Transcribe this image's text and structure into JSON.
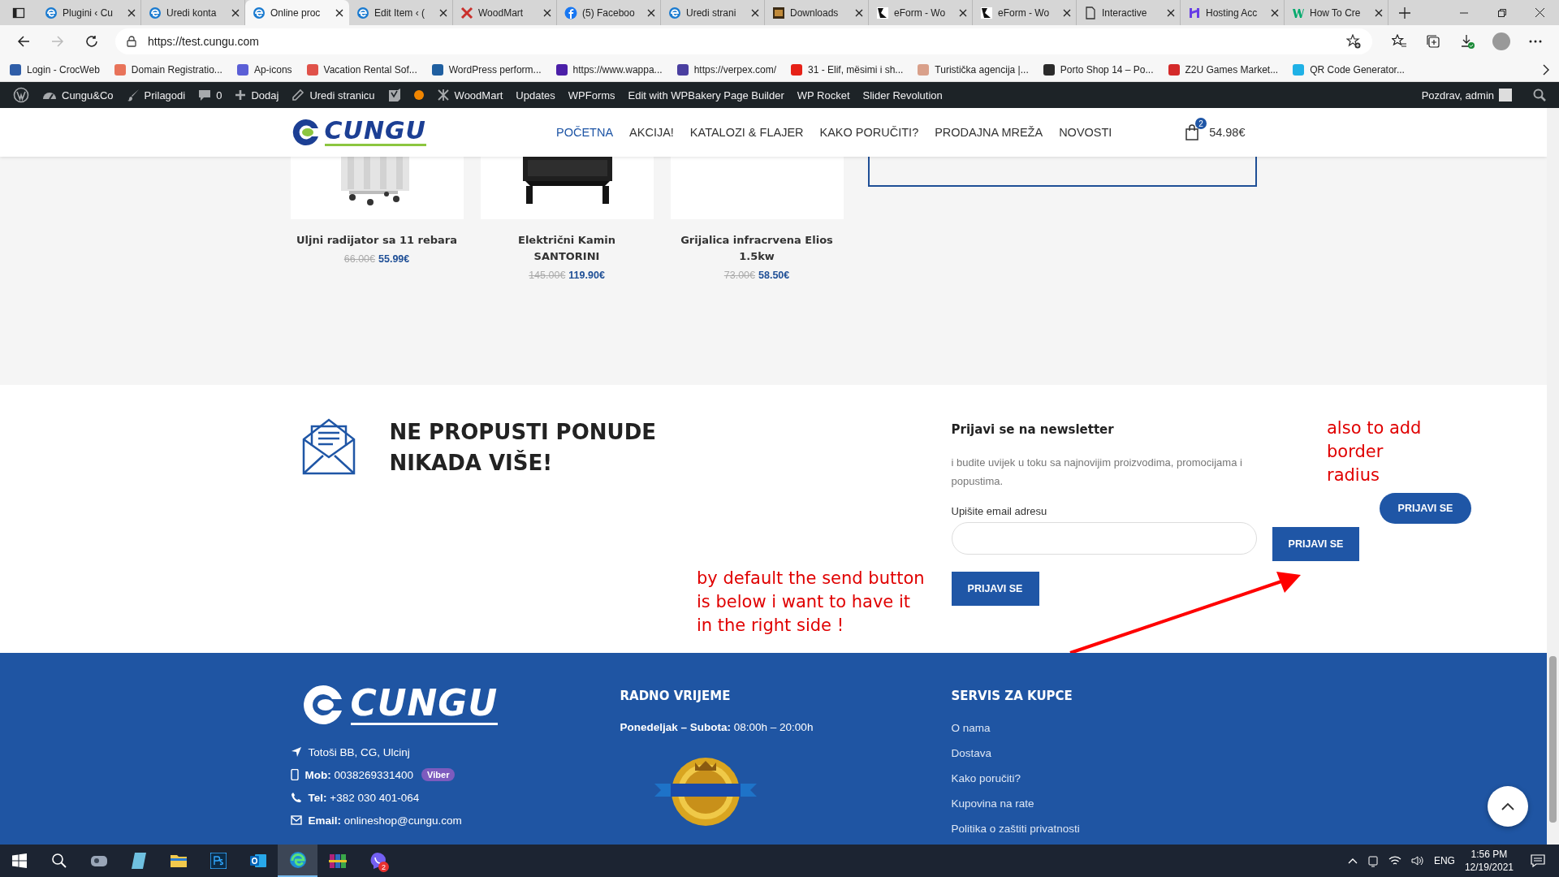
{
  "browser": {
    "tabs": [
      {
        "title": "Plugini ‹ Cu",
        "kind": "edge",
        "selected": false
      },
      {
        "title": "Uredi konta",
        "kind": "edge",
        "selected": false
      },
      {
        "title": "Online proc",
        "kind": "edge",
        "selected": true
      },
      {
        "title": "Edit Item ‹ (",
        "kind": "edge",
        "selected": false
      },
      {
        "title": "WoodMart",
        "kind": "woodmart",
        "selected": false
      },
      {
        "title": "(5) Faceboo",
        "kind": "facebook",
        "selected": false
      },
      {
        "title": "Uredi strani",
        "kind": "edge",
        "selected": false
      },
      {
        "title": "Downloads",
        "kind": "downloads",
        "selected": false
      },
      {
        "title": "eForm - Wo",
        "kind": "eform",
        "selected": false
      },
      {
        "title": "eForm - Wo",
        "kind": "eform",
        "selected": false
      },
      {
        "title": "Interactive",
        "kind": "page",
        "selected": false
      },
      {
        "title": "Hosting Acc",
        "kind": "hosting",
        "selected": false
      },
      {
        "title": "How To Cre",
        "kind": "w3",
        "selected": false
      }
    ],
    "url": "https://test.cungu.com",
    "bookmarks": [
      {
        "label": "Login - CrocWeb",
        "color": "#2f5ea8"
      },
      {
        "label": "Domain Registratio...",
        "color": "#e8735a"
      },
      {
        "label": "Ap-icons",
        "color": "#5b5fd6"
      },
      {
        "label": "Vacation Rental Sof...",
        "color": "#e0524a"
      },
      {
        "label": "WordPress perform...",
        "color": "#1f5fa0"
      },
      {
        "label": "https://www.wappa...",
        "color": "#4b1fa8"
      },
      {
        "label": "https://verpex.com/",
        "color": "#4a3fa0"
      },
      {
        "label": "31 - Elif, mësimi i sh...",
        "color": "#e62117"
      },
      {
        "label": "Turistička agencija |...",
        "color": "#d9a08a"
      },
      {
        "label": "Porto Shop 14 – Po...",
        "color": "#2b2b2b"
      },
      {
        "label": "Z2U Games Market...",
        "color": "#d42a2a"
      },
      {
        "label": "QR Code Generator...",
        "color": "#1fb1e6"
      }
    ]
  },
  "admin_bar": {
    "items": [
      {
        "kind": "wp"
      },
      {
        "kind": "dashboard",
        "label": "Cungu&Co"
      },
      {
        "kind": "brush",
        "label": "Prilagodi"
      },
      {
        "kind": "comment",
        "label": "0"
      },
      {
        "kind": "plus",
        "label": "Dodaj"
      },
      {
        "kind": "pencil",
        "label": "Uredi stranicu"
      },
      {
        "kind": "yoast"
      },
      {
        "kind": "dot"
      },
      {
        "kind": "woodmart",
        "label": "WoodMart"
      },
      {
        "kind": "text",
        "label": "Updates"
      },
      {
        "kind": "text",
        "label": "WPForms"
      },
      {
        "kind": "text",
        "label": "Edit with WPBakery Page Builder"
      },
      {
        "kind": "text",
        "label": "WP Rocket"
      },
      {
        "kind": "text",
        "label": "Slider Revolution"
      }
    ],
    "greeting": "Pozdrav, admin"
  },
  "header": {
    "logo": "CUNGU",
    "nav": [
      {
        "label": "POČETNA",
        "selected": true
      },
      {
        "label": "AKCIJA!",
        "selected": false
      },
      {
        "label": "KATALOZI & FLAJER",
        "selected": false
      },
      {
        "label": "KAKO PORUČITI?",
        "selected": false
      },
      {
        "label": "PRODAJNA MREŽA",
        "selected": false
      },
      {
        "label": "NOVOSTI",
        "selected": false
      }
    ],
    "cart_count": "2",
    "cart_total": "54.98€"
  },
  "products": [
    {
      "title": "Uljni radijator sa 11 rebara",
      "old_price": "66.00€",
      "price": "55.99€",
      "kind": "picture"
    },
    {
      "title": "Električni Kamin SANTORINI",
      "old_price": "145.00€",
      "price": "119.90€",
      "kind": "picture"
    },
    {
      "title": "Grijalica infracrvena Elios 1.5kw",
      "old_price": "73.00€",
      "price": "58.50€"
    }
  ],
  "newsletter": {
    "heading": "NE PROPUSTI PONUDE NIKADA VIŠE!",
    "title": "Prijavi se na newsletter",
    "description": "i budite uvijek u toku sa najnovijim proizvodima, promocijama i popustima.",
    "email_label": "Upišite email adresu",
    "button": "PRIJAVI SE"
  },
  "annotations": {
    "note_below": "by default the send button is below i want to have it in the right side !",
    "note_radius": "also to add border radius",
    "mock_buttons": [
      {
        "label": "PRIJAVI SE",
        "kind": "square"
      },
      {
        "label": "PRIJAVI SE",
        "kind": "pill"
      }
    ]
  },
  "footer": {
    "logo": "CUNGU",
    "contacts": [
      {
        "kind": "location",
        "value": "Totoši BB, CG, Ulcinj"
      },
      {
        "kind": "mobile",
        "label": "Mob:",
        "value": "0038269331400",
        "badge": "Viber"
      },
      {
        "kind": "phone",
        "label": "Tel:",
        "value": "+382 030 401-064"
      },
      {
        "kind": "email",
        "label": "Email:",
        "value": "onlineshop@cungu.com"
      }
    ],
    "hours_title": "RADNO VRIJEME",
    "hours_label": "Ponedeljak – Subota:",
    "hours_value": "08:00h – 20:00h",
    "service_title": "SERVIS ZA KUPCE",
    "links": [
      "O nama",
      "Dostava",
      "Kako poručiti?",
      "Kupovina na rate",
      "Politika o zaštiti privatnosti"
    ]
  },
  "taskbar": {
    "apps": [
      {
        "kind": "search",
        "active": false
      },
      {
        "kind": "taskview",
        "active": false
      },
      {
        "kind": "notes",
        "active": false
      },
      {
        "kind": "explorer",
        "active": false
      },
      {
        "kind": "photoshop",
        "active": false
      },
      {
        "kind": "outlook",
        "active": false
      },
      {
        "kind": "edge",
        "active": true
      },
      {
        "kind": "winrar",
        "active": false
      },
      {
        "kind": "viber",
        "active": false,
        "badge": "2"
      }
    ],
    "language": "ENG",
    "time": "1:56 PM",
    "date": "12/19/2021"
  }
}
